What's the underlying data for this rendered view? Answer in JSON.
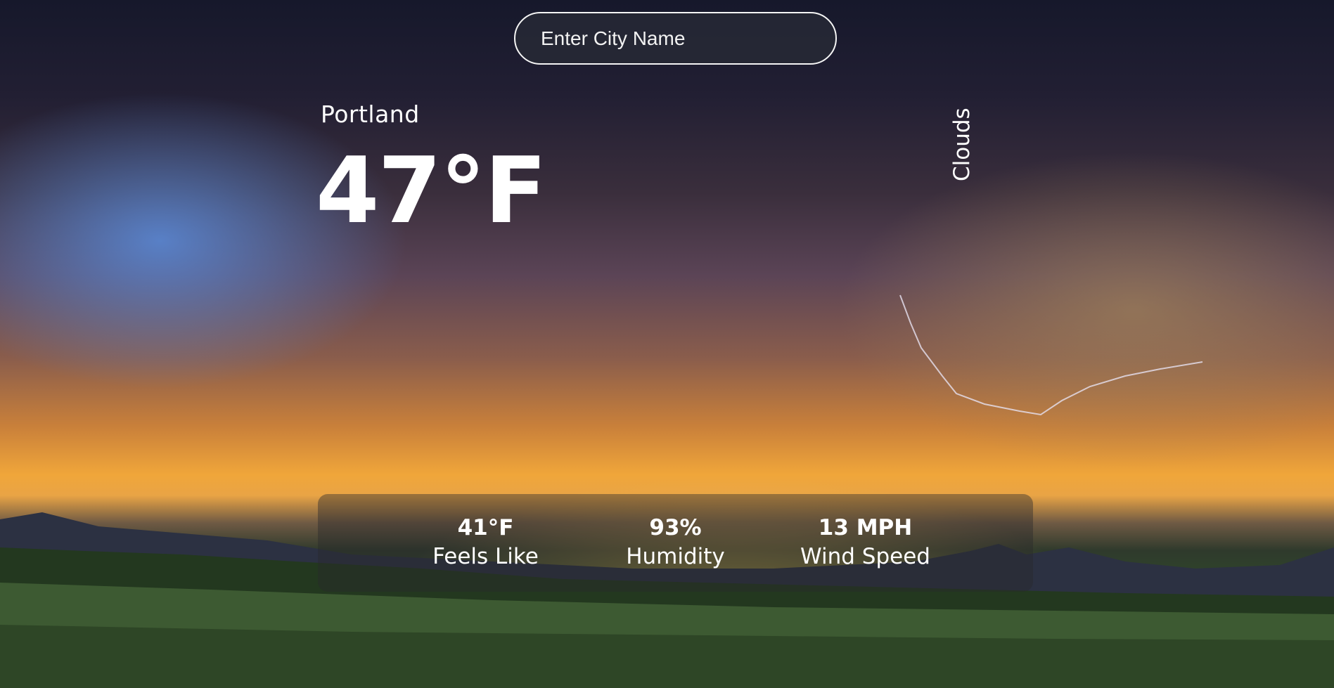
{
  "search": {
    "placeholder": "Enter City Name"
  },
  "weather": {
    "city": "Portland",
    "temperature": "47°F",
    "condition": "Clouds"
  },
  "stats": [
    {
      "value": "41°F",
      "label": "Feels Like"
    },
    {
      "value": "93%",
      "label": "Humidity"
    },
    {
      "value": "13 MPH",
      "label": "Wind Speed"
    }
  ],
  "colors": {
    "text": "#ffffff",
    "search_border": "#f5f5f5",
    "search_background": "#282a36",
    "panel_background": "#28282c"
  }
}
